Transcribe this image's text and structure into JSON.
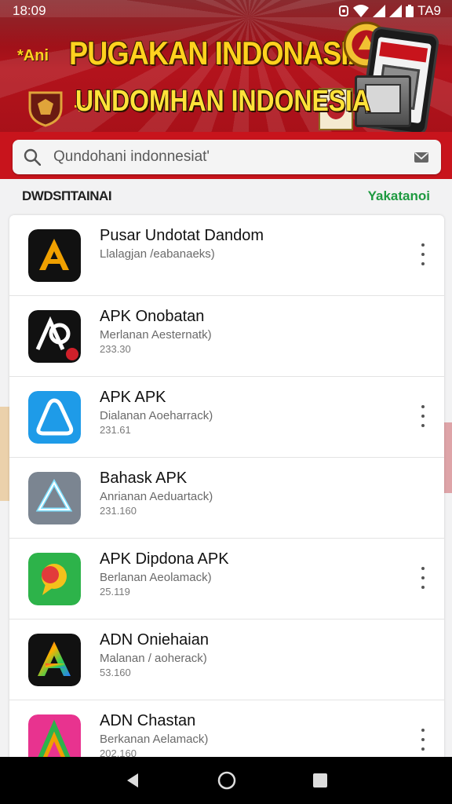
{
  "status_bar": {
    "time": "18:09",
    "network": "TA9"
  },
  "banner": {
    "prefix": "*Ani",
    "title": "PUGAKAN INDONASIAR",
    "plus": "+",
    "subtitle": "UNDOMHAN INDONESIA"
  },
  "search": {
    "placeholder": "Qundohani indonnesiat'"
  },
  "section": {
    "title": "DWDSПTAINAI",
    "link": "Yakatanoi"
  },
  "apps": [
    {
      "name": "Pusar Undotat Dandom",
      "subtitle": "Llalagjan /eabanaeks)",
      "meta": "",
      "has_menu": true,
      "icon": "letter-a-black-orange-icon"
    },
    {
      "name": "APK  Onobatan",
      "subtitle": "Merlanan Aesternatk)",
      "meta": "233.30",
      "has_menu": false,
      "icon": "ap-logo-black-icon"
    },
    {
      "name": "APK  APK",
      "subtitle": "Dialanan Aoeharrack)",
      "meta": "231.61",
      "has_menu": true,
      "icon": "triangle-blue-icon"
    },
    {
      "name": "Bahask APK",
      "subtitle": "Anrianan Aeduartack)",
      "meta": "231.160",
      "has_menu": false,
      "icon": "triangle-gray-icon"
    },
    {
      "name": "APK Dipdona APK",
      "subtitle": "Berlanan Aeolamack)",
      "meta": "25.119",
      "has_menu": true,
      "icon": "bubble-green-icon"
    },
    {
      "name": "ADN Oniehaian",
      "subtitle": "Malanan / aoherack)",
      "meta": "53.160",
      "has_menu": false,
      "icon": "letter-a-rainbow-icon"
    },
    {
      "name": "ADN Chastan",
      "subtitle": "Berkanan Aelamack)",
      "meta": "202.160",
      "has_menu": true,
      "icon": "letter-a-pink-icon"
    }
  ],
  "colors": {
    "banner_red": "#b3131c",
    "accent_green": "#1e9a40",
    "title_yellow": "#ffd21f"
  }
}
